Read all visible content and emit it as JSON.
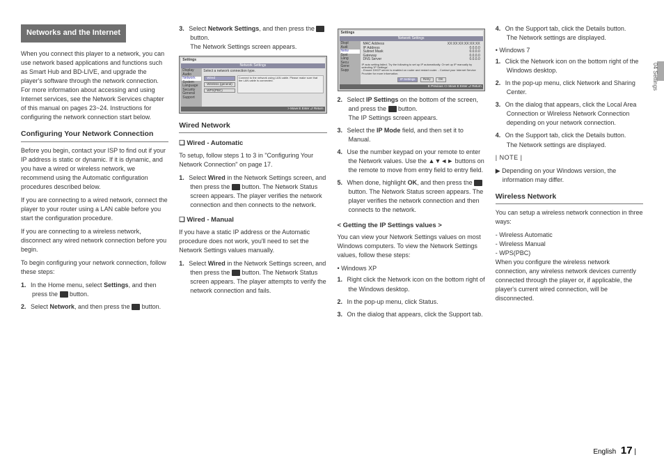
{
  "sideTab": "04    Settings",
  "header": "Networks and the Internet",
  "col1": {
    "intro": "When you connect this player to a network, you can use network based applications and functions such as Smart Hub and BD-LIVE, and upgrade the player's software through the network connection. For more information about accessing and using Internet services, see the Network Services chapter of this manual on pages 23~24. Instructions for configuring the network connection start below.",
    "subhead": "Configuring Your Network Connection",
    "p1": "Before you begin, contact your ISP to find out if your IP address is static or dynamic. If it is dynamic, and you have a wired or wireless network, we recommend using the Automatic configuration procedures described below.",
    "p2": "If you are connecting to a wired network, connect the player to your router using a LAN cable before you start the configuration procedure.",
    "p3": "If you are connecting to a wireless network, disconnect any wired network connection before you begin.",
    "p4": "To begin configuring your network connection, follow these steps:",
    "li1a": "In the Home menu, select ",
    "li1b": "Settings",
    "li1c": ", and then press the ",
    "li1d": " button.",
    "li2a": "Select ",
    "li2b": "Network",
    "li2c": ", and then press the ",
    "li2d": " button."
  },
  "col2": {
    "li3a": "Select ",
    "li3b": "Network Settings",
    "li3c": ", and then press the ",
    "li3d": " button.",
    "li3e": "The Network Settings screen appears.",
    "fig1": {
      "title": "Settings",
      "header": "Network Settings",
      "menu": [
        "Display",
        "Audio",
        "Network",
        "System",
        "Language",
        "Security",
        "General",
        "Support"
      ],
      "line1": "Select a network connection type.",
      "buttons": [
        "Wired",
        "Wireless (general)",
        "WPS(PBC)"
      ],
      "note": "Connect to the network using LAN cable. Please make sure that the LAN cable is connected.",
      "foot": "> Move   E Enter   ⮐ Return"
    },
    "subhead": "Wired Network",
    "sub2a": "❑ Wired - Automatic",
    "p1": "To setup, follow steps 1 to 3 in \"Configuring Your Network Connection\" on page 17.",
    "li1a": "Select ",
    "li1b": "Wired",
    "li1c": " in the Network Settings screen, and then press the ",
    "li1d": " button. The Network Status screen appears. The player verifies the network connection and then connects to the network.",
    "sub2b": "❑ Wired - Manual",
    "p2": "If you have a static IP address or the Automatic procedure does not work, you'll need to set the Network Settings values manually.",
    "li2a": "Select ",
    "li2b": "Wired",
    "li2c": " in the Network Settings screen, and then press the ",
    "li2d": " button. The Network Status screen appears. The player attempts to verify the network connection and fails."
  },
  "col3": {
    "fig2": {
      "title": "Settings",
      "header": "Network Settings",
      "rows": [
        [
          "MAC Address",
          "XX:XX:XX:XX:XX:XX"
        ],
        [
          "IP Address",
          "0.0.0.0"
        ],
        [
          "Subnet Mask",
          "0.0.0.0"
        ],
        [
          "Gateway",
          "0.0.0.0"
        ],
        [
          "DNS Server",
          "0.0.0.0"
        ]
      ],
      "msg": "IP auto setting failed. Try the following to set up IP automatically. Or set up IP manually by selecting 'IP Settings'.",
      "msg2": "- Ensure DHCP server is enabled on router and restart router.\n- Contact your Internet Service Provider for more information.",
      "buttons": [
        "IP Settings",
        "Retry",
        "OK"
      ],
      "foot": "E Previous   <> Move   E Enter   ⮐ Return"
    },
    "li2a": "Select ",
    "li2b": "IP Settings",
    "li2c": " on the bottom of the screen, and press the ",
    "li2d": " button.",
    "li2e": "The IP Settings screen appears.",
    "li3a": "Select the ",
    "li3b": "IP Mode",
    "li3c": " field, and then set it to Manual.",
    "li4": "Use the number keypad on your remote to enter the Network values. Use the ▲▼◄► buttons on the remote to move from entry field to entry field.",
    "li5a": "When done, highlight ",
    "li5b": "OK",
    "li5c": ", and then press the ",
    "li5d": " button. The Network Status screen appears. The player verifies the network connection and then connects to the network.",
    "subhead": "< Getting the IP Settings values >",
    "p1": "You can view your Network Settings values on most Windows computers. To view the Network Settings values, follow these steps:",
    "bullet1": "Windows XP",
    "xp1": "Right click the Network icon on the bottom right of the Windows desktop.",
    "xp2": "In the pop-up menu, click Status.",
    "xp3": "On the dialog that appears, click the Support tab."
  },
  "col4": {
    "xp4": "On the Support tab, click the Details button.",
    "xp4b": "The Network settings are displayed.",
    "bullet2": "Windows 7",
    "w71": "Click the Network icon on the bottom right of the Windows desktop.",
    "w72": "In the pop-up menu, click Network and Sharing Center.",
    "w73": "On the dialog that appears, click the Local Area Connection or Wireless Network Connection depending on your network connection.",
    "w74": "On the Support tab, click the Details button.",
    "w74b": "The Network settings are displayed.",
    "noteLabel": "| NOTE |",
    "note": "Depending on your Windows version, the information may differ.",
    "subhead": "Wireless Network",
    "p1": "You can setup a wireless network connection in three ways:",
    "ways": [
      "Wireless Automatic",
      "Wireless Manual",
      "WPS(PBC)"
    ],
    "p2": "When you configure the wireless network connection, any wireless network devices currently connected through the player or, if applicable, the player's current wired connection, will be disconnected."
  },
  "footer": {
    "lang": "English",
    "page": "17",
    "bar": "|"
  }
}
